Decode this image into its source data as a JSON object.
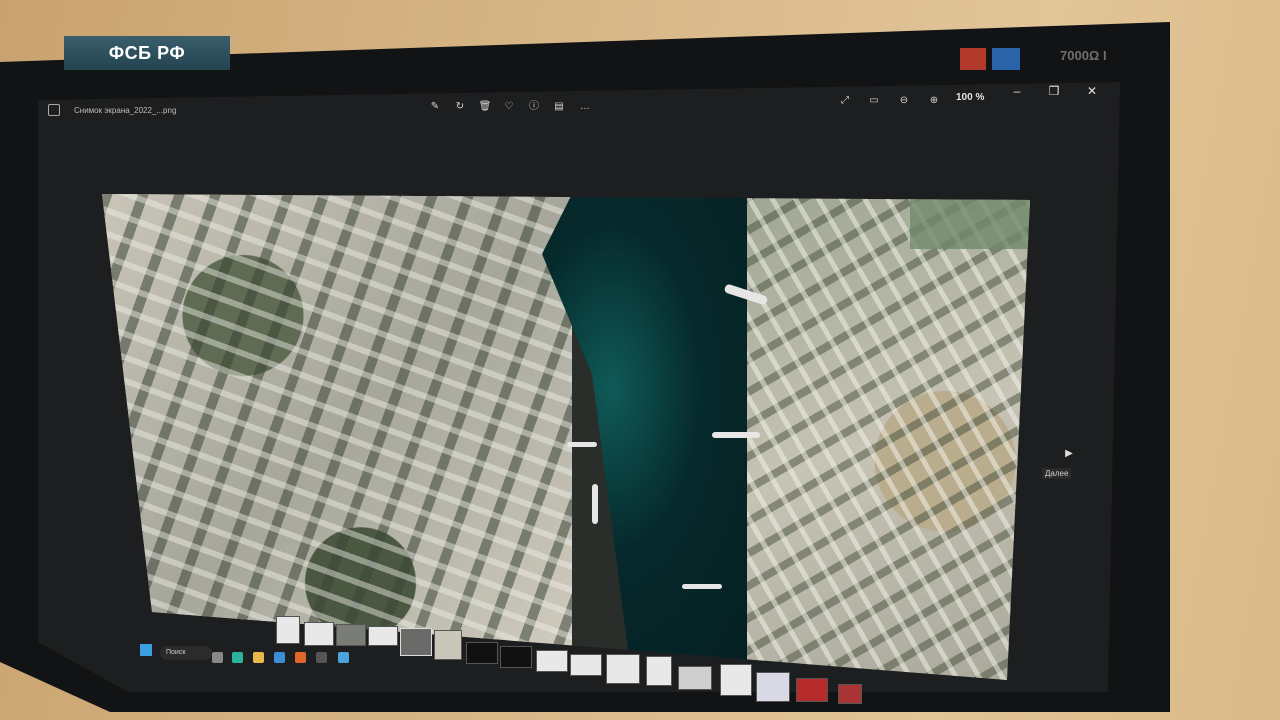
{
  "overlay": {
    "badge_text": "ФСБ РФ"
  },
  "monitor": {
    "brand_text": "7000Ω I"
  },
  "viewer": {
    "filename": "Снимок экрана_2022_...png",
    "zoom": "100 %",
    "toolbar_icons": [
      "edit-icon",
      "rotate-icon",
      "delete-icon",
      "favorite-icon",
      "info-icon",
      "print-icon",
      "more-icon"
    ],
    "right_controls": [
      "fullscreen-icon",
      "fit-icon",
      "zoom-out-icon",
      "zoom-in-icon"
    ],
    "window_buttons": {
      "minimize": "–",
      "restore": "❐",
      "close": "✕"
    },
    "side_nav_label": "Далее",
    "side_nav_arrow": "▶"
  },
  "taskbar": {
    "search_placeholder": "Поиск"
  }
}
